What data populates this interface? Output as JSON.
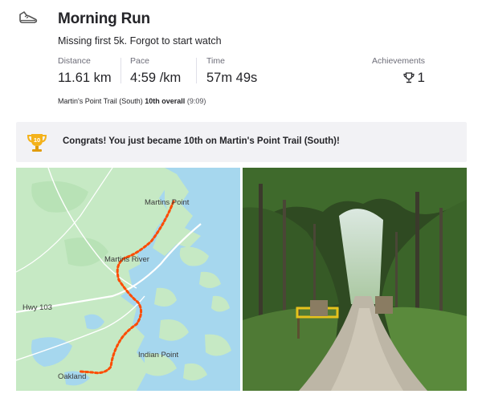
{
  "activity": {
    "title": "Morning Run",
    "description": "Missing first 5k. Forgot to start watch"
  },
  "stats": [
    {
      "label": "Distance",
      "value": "11.61 km"
    },
    {
      "label": "Pace",
      "value": "4:59 /km"
    },
    {
      "label": "Time",
      "value": "57m 49s"
    }
  ],
  "achievements": {
    "label": "Achievements",
    "count": "1"
  },
  "segment": {
    "name": "Martin's Point Trail (South)",
    "rank": "10th overall",
    "time": "(9:09)"
  },
  "banner": {
    "badge_number": "10",
    "text": "Congrats! You just became 10th on Martin's Point Trail (South)!"
  },
  "map": {
    "labels": {
      "martins_point": "Martins Point",
      "martins_river": "Martins River",
      "hwy": "Hwy 103",
      "indian_point": "Indian Point",
      "oakland": "Oakland"
    },
    "route_color": "#fc4c02",
    "water_color": "#a6d7ee",
    "land_color": "#c6e9c4"
  },
  "icons": {
    "activity_type": "running-shoe-icon",
    "achievement": "trophy-icon",
    "banner": "gold-trophy-icon"
  },
  "colors": {
    "text": "#242428",
    "label": "#6d6d78",
    "banner_bg": "#f2f2f5",
    "trophy_gold": "#f4b21b"
  }
}
